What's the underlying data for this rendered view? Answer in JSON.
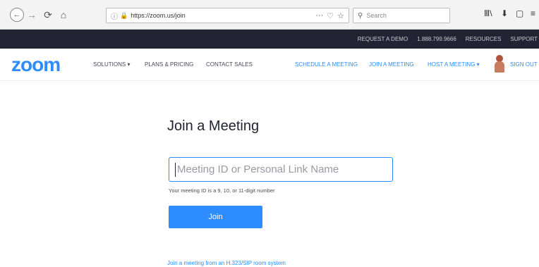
{
  "browser": {
    "back_glyph": "←",
    "forward_glyph": "→",
    "reload_glyph": "⟳",
    "home_glyph": "⌂",
    "info_glyph": "ⓘ",
    "lock_glyph": "🔒",
    "url": "https://zoom.us/join",
    "url_actions": [
      "···",
      "♡",
      "☆"
    ],
    "search_icon_glyph": "⚲",
    "search_placeholder": "Search",
    "toolbar_icons": [
      "Ⅲ\\",
      "⬇",
      "▢",
      "≡"
    ]
  },
  "top_bar": {
    "links": [
      "REQUEST A DEMO",
      "1.888.799.9666",
      "RESOURCES",
      "SUPPORT"
    ]
  },
  "main_nav": {
    "logo": "zoom",
    "links": [
      "SOLUTIONS ▾",
      "PLANS & PRICING",
      "CONTACT SALES"
    ],
    "right_links": [
      "SCHEDULE A MEETING",
      "JOIN A MEETING",
      "HOST A MEETING ▾"
    ],
    "sign_out": "SIGN OUT"
  },
  "main": {
    "title": "Join a Meeting",
    "input_placeholder": "Meeting ID or Personal Link Name",
    "helper": "Your meeting ID is a 9, 10, or 11-digit number",
    "join_label": "Join",
    "h323_link": "Join a meeting from an H.323/SIP room system"
  },
  "colors": {
    "accent": "#2d8cff",
    "topbar": "#232333"
  }
}
